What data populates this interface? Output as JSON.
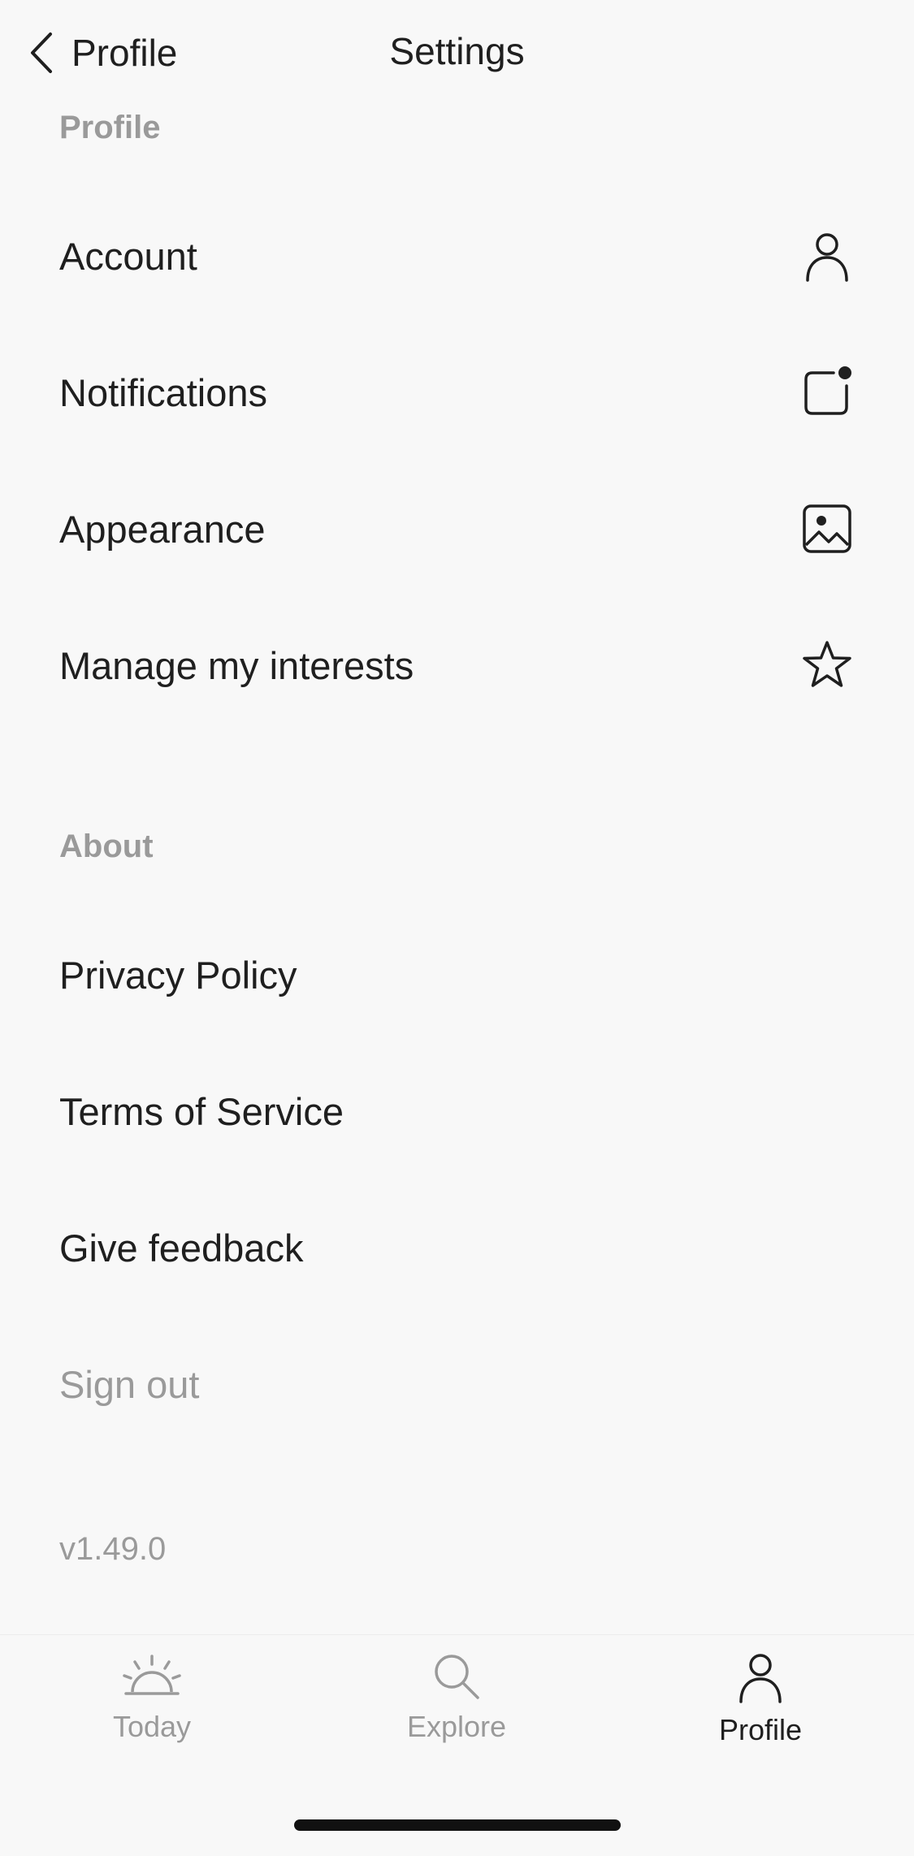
{
  "header": {
    "back_label": "Profile",
    "title": "Settings"
  },
  "sections": {
    "profile": {
      "header": "Profile",
      "items": [
        {
          "label": "Account",
          "icon": "person-icon"
        },
        {
          "label": "Notifications",
          "icon": "notification-square-icon"
        },
        {
          "label": "Appearance",
          "icon": "image-icon"
        },
        {
          "label": "Manage my interests",
          "icon": "star-icon"
        }
      ]
    },
    "about": {
      "header": "About",
      "items": [
        {
          "label": "Privacy Policy"
        },
        {
          "label": "Terms of Service"
        },
        {
          "label": "Give feedback"
        }
      ]
    }
  },
  "sign_out": "Sign out",
  "version": "v1.49.0",
  "tabbar": {
    "tabs": [
      {
        "label": "Today",
        "icon": "sunrise-icon",
        "active": false
      },
      {
        "label": "Explore",
        "icon": "search-icon",
        "active": false
      },
      {
        "label": "Profile",
        "icon": "person-icon",
        "active": true
      }
    ]
  },
  "colors": {
    "background": "#f8f8f8",
    "text": "#1f1f1f",
    "muted": "#9a9a9a"
  }
}
